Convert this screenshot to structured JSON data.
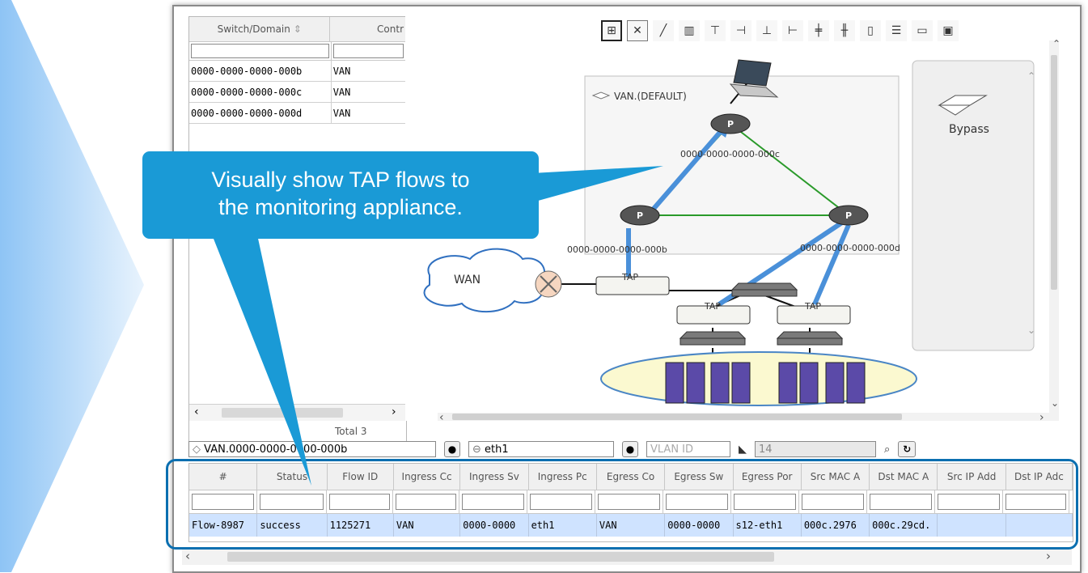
{
  "callout": {
    "line1": "Visually show TAP flows to",
    "line2": "the monitoring appliance."
  },
  "switch_table": {
    "columns": [
      "Switch/Domain",
      "Contr"
    ],
    "rows": [
      {
        "switch": "0000-0000-0000-000b",
        "controller": "VAN"
      },
      {
        "switch": "0000-0000-0000-000c",
        "controller": "VAN"
      },
      {
        "switch": "0000-0000-0000-000d",
        "controller": "VAN"
      }
    ],
    "total": "Total 3"
  },
  "topology": {
    "domain_label": "VAN.(DEFAULT)",
    "switch_c": "0000-0000-0000-000c",
    "switch_b": "0000-0000-0000-000b",
    "switch_d": "0000-0000-0000-000d",
    "wan_label": "WAN",
    "tap_label": "TAP",
    "bypass_label": "Bypass",
    "toolbar_icons": [
      "layout-icon",
      "close-box-icon",
      "link-icon",
      "delete-icon",
      "align-top-icon",
      "align-right-icon",
      "align-bottom-icon",
      "align-left-icon",
      "center-horizontal-icon",
      "center-vertical-icon",
      "distribute-horizontal-icon",
      "distribute-vertical-icon",
      "fit-window-icon",
      "save-icon"
    ]
  },
  "search": {
    "domain_value": "VAN.0000-0000-0000-000b",
    "port_value": "eth1",
    "vlan_placeholder": "VLAN ID",
    "count_value": "14"
  },
  "flow_table": {
    "columns": [
      "#",
      "Status",
      "Flow ID",
      "Ingress Cc",
      "Ingress Sv",
      "Ingress Pc",
      "Egress Co",
      "Egress Sw",
      "Egress Por",
      "Src MAC A",
      "Dst MAC A",
      "Src IP Add",
      "Dst IP Adc"
    ],
    "row": [
      "Flow-8987",
      "success",
      "1125271",
      "VAN",
      "0000-0000",
      "eth1",
      "VAN",
      "0000-0000",
      "s12-eth1",
      "000c.2976",
      "000c.29cd.",
      "",
      ""
    ]
  },
  "colors": {
    "accent": "#1a9ad6",
    "highlight_border": "#0b6fb0",
    "selected_row": "#cfe3ff",
    "link_green": "#2a9a2a",
    "tap_flow_blue": "#4a90d9"
  }
}
